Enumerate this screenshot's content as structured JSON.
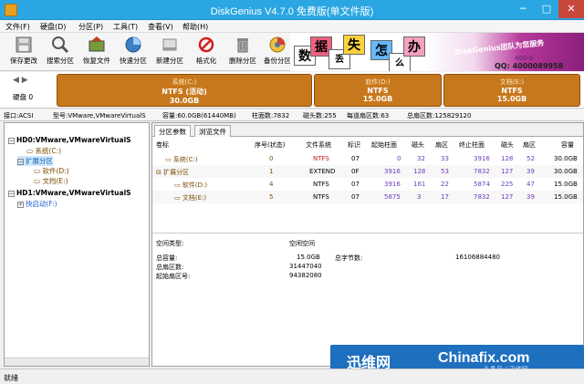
{
  "window": {
    "title": "DiskGenius V4.7.0 免费版(单文件版)",
    "min": "─",
    "max": "□",
    "close": "✕"
  },
  "menu": [
    "文件(F)",
    "硬盘(D)",
    "分区(P)",
    "工具(T)",
    "查看(V)",
    "帮助(H)"
  ],
  "toolbar": [
    {
      "label": "保存更改",
      "icon": "save-icon"
    },
    {
      "label": "搜索分区",
      "icon": "search-icon"
    },
    {
      "label": "恢复文件",
      "icon": "recover-icon"
    },
    {
      "label": "快速分区",
      "icon": "quick-partition-icon"
    },
    {
      "label": "新建分区",
      "icon": "new-partition-icon"
    },
    {
      "label": "格式化",
      "icon": "format-icon"
    },
    {
      "label": "删除分区",
      "icon": "trash-icon"
    },
    {
      "label": "备份分区",
      "icon": "backup-icon"
    }
  ],
  "banner": {
    "tiles": [
      "数",
      "据",
      "丢",
      "失",
      "怎",
      "么",
      "办"
    ],
    "slogan": "DiskGenius团队为您服务",
    "phone": "400-0",
    "qq": "QQ: 4000089958"
  },
  "diskbar": {
    "nav": "◀ ▶",
    "disk_label": "硬盘 0",
    "partitions": [
      {
        "name": "系统(C:)",
        "fs": "NTFS (活动)",
        "size": "30.0GB"
      },
      {
        "name": "软件(D:)",
        "fs": "NTFS",
        "size": "15.0GB"
      },
      {
        "name": "文档(E:)",
        "fs": "NTFS",
        "size": "15.0GB"
      }
    ]
  },
  "infobar": {
    "interface": "接口:ACSI",
    "model": "型号:VMware,VMwareVirtualS",
    "capacity": "容量:60.0GB(61440MB)",
    "cylinders": "柱面数:7832",
    "heads": "磁头数:255",
    "sectors_per_track": "每道扇区数:63",
    "total_sectors": "总扇区数:125829120"
  },
  "tree": {
    "disk0": "HD0:VMware,VMwareVirtualS",
    "system": "系统(C:)",
    "extended": "扩展分区",
    "software": "软件(D:)",
    "docs": "文档(E:)",
    "disk1": "HD1:VMware,VMwareVirtualS",
    "quickstart": "快启动(F:)"
  },
  "tabs": [
    "分区参数",
    "浏览文件"
  ],
  "table": {
    "headers": [
      "卷标",
      "序号(状态)",
      "文件系统",
      "标识",
      "起始柱面",
      "磁头",
      "扇区",
      "终止柱面",
      "磁头",
      "扇区",
      "容量"
    ],
    "rows": [
      [
        "系统(C:)",
        "0",
        "NTFS",
        "07",
        "0",
        "32",
        "33",
        "3916",
        "128",
        "52",
        "30.0GB"
      ],
      [
        "扩展分区",
        "1",
        "EXTEND",
        "0F",
        "3916",
        "128",
        "53",
        "7832",
        "127",
        "39",
        "30.0GB"
      ],
      [
        "软件(D:)",
        "4",
        "NTFS",
        "07",
        "3916",
        "161",
        "22",
        "5874",
        "225",
        "47",
        "15.0GB"
      ],
      [
        "文档(E:)",
        "5",
        "NTFS",
        "07",
        "5875",
        "3",
        "17",
        "7832",
        "127",
        "39",
        "15.0GB"
      ]
    ]
  },
  "details": {
    "space_type_label": "空间类型:",
    "space_type_value": "空闲空间",
    "total_label": "总容量:",
    "total_value": "15.0GB",
    "total_bytes_label": "总字节数:",
    "total_bytes_value": "16106884480",
    "sector_count_label": "总扇区数:",
    "sector_count_value": "31447040",
    "start_sector_label": "起始扇区号:",
    "start_sector_value": "94382080"
  },
  "watermark": {
    "brand_cn": "迅维网",
    "brand_en": "Chinafix.com",
    "sub": "头条号 / 迅维网"
  },
  "status": "就绪"
}
